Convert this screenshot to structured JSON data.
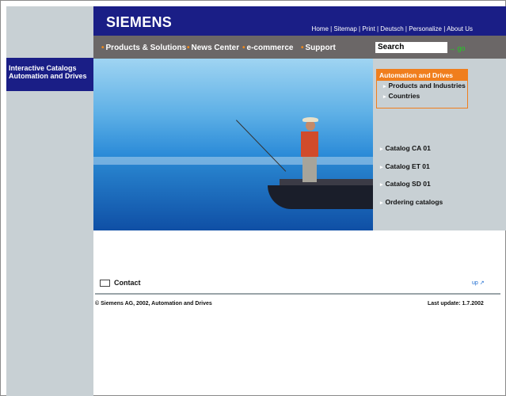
{
  "header": {
    "brand": "SIEMENS",
    "links": [
      "Home",
      "Sitemap",
      "Print",
      "Deutsch",
      "Personalize",
      "About Us"
    ]
  },
  "nav": {
    "items": [
      "Products & Solutions",
      "News Center",
      "e-commerce",
      "Support"
    ],
    "search_placeholder": "Search",
    "go_label": "go"
  },
  "sidebar": {
    "title_line1": "Interactive Catalogs",
    "title_line2": "Automation and Drives"
  },
  "right_menu": {
    "heading": "Automation and Drives",
    "items": [
      "Products and Industries",
      "Countries"
    ]
  },
  "catalogs": [
    "Catalog CA 01",
    "Catalog ET 01",
    "Catalog SD 01",
    "Ordering catalogs"
  ],
  "footer": {
    "contact": "Contact",
    "up": "up",
    "copyright": "© Siemens AG, 2002, Automation and Drives",
    "last_update": "Last update: 1.7.2002"
  },
  "colors": {
    "brand_blue": "#1a1e86",
    "nav_grey": "#6b6767",
    "accent_orange": "#f07e1d",
    "panel_grey": "#c8d0d4"
  }
}
